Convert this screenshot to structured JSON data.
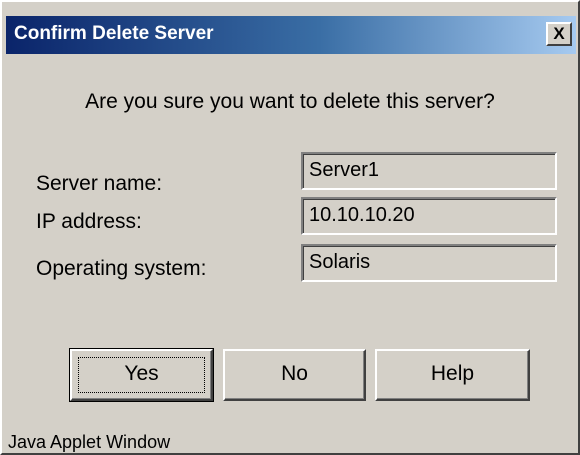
{
  "dialog": {
    "title": "Confirm Delete Server",
    "close_label": "X",
    "question": "Are you sure you want to delete this server?"
  },
  "fields": [
    {
      "label": "Server name:",
      "value": "Server1"
    },
    {
      "label": "IP address:",
      "value": "10.10.10.20"
    },
    {
      "label": "Operating system:",
      "value": "Solaris"
    }
  ],
  "buttons": {
    "yes": "Yes",
    "no": "No",
    "help": "Help"
  },
  "status_bar": "Java Applet Window",
  "colors": {
    "title_gradient_start": "#0a246a",
    "title_gradient_end": "#a6caf0",
    "dialog_background": "#d4d0c8"
  }
}
